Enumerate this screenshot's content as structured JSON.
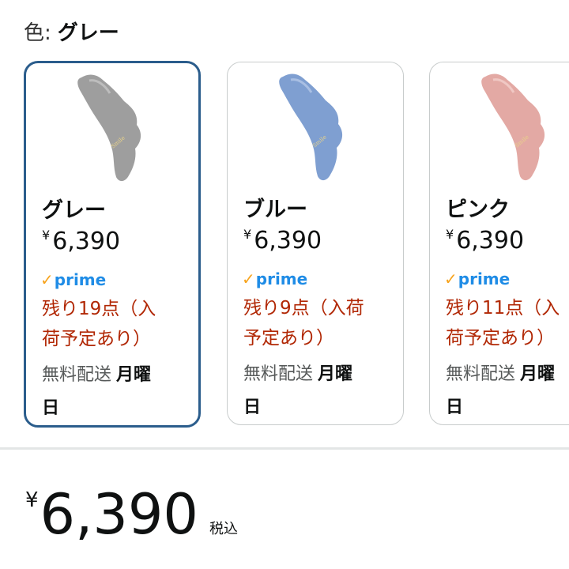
{
  "header": {
    "color_label": "色:",
    "selected_color": "グレー"
  },
  "variants": [
    {
      "name": "グレー",
      "currency": "¥",
      "price": "6,390",
      "prime": "prime",
      "stock_line1": "残り19点（入",
      "stock_line2": "荷予定あり）",
      "shipping": "無料配送",
      "delivery_day_1": "月曜",
      "delivery_day_2": "日",
      "color": "#9e9e9e",
      "selected": true
    },
    {
      "name": "ブルー",
      "currency": "¥",
      "price": "6,390",
      "prime": "prime",
      "stock_line1": "残り9点（入荷",
      "stock_line2": "予定あり）",
      "shipping": "無料配送",
      "delivery_day_1": "月曜",
      "delivery_day_2": "日",
      "color": "#7f9fd1",
      "selected": false
    },
    {
      "name": "ピンク",
      "currency": "¥",
      "price": "6,390",
      "prime": "prime",
      "stock_line1": "残り11点（入",
      "stock_line2": "荷予定あり）",
      "shipping": "無料配送",
      "delivery_day_1": "月曜",
      "delivery_day_2": "日",
      "color": "#e3a9a4",
      "selected": false
    }
  ],
  "total": {
    "currency": "¥",
    "amount": "6,390",
    "tax_label": "税込"
  },
  "colors": {
    "selected_border": "#2b5d8c",
    "stock_red": "#b12704",
    "prime_blue": "#1f8ce6",
    "prime_check": "#f7a31c"
  }
}
